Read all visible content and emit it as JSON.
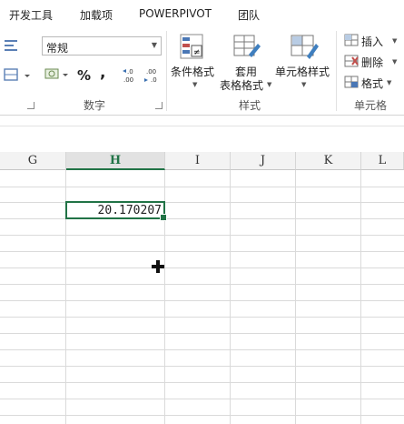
{
  "tabs": [
    "开发工具",
    "加载项",
    "POWERPIVOT",
    "团队"
  ],
  "number_group": {
    "format_value": "常规",
    "percent_symbol": "%",
    "comma_symbol": ",",
    "inc_decimal": "←.0\n.00",
    "dec_decimal": ".00\n→.0",
    "label": "数字"
  },
  "styles_group": {
    "conditional_format": "条件格式",
    "table_format_line1": "套用",
    "table_format_line2": "表格格式",
    "cell_styles": "单元格样式",
    "label": "样式"
  },
  "cells_group": {
    "insert": "插入",
    "delete": "删除",
    "format": "格式",
    "label": "单元格"
  },
  "columns": [
    "G",
    "H",
    "I",
    "J",
    "K",
    "L"
  ],
  "selected_column": "H",
  "active_cell_value": "20.170207",
  "colors": {
    "accent": "#217346"
  }
}
